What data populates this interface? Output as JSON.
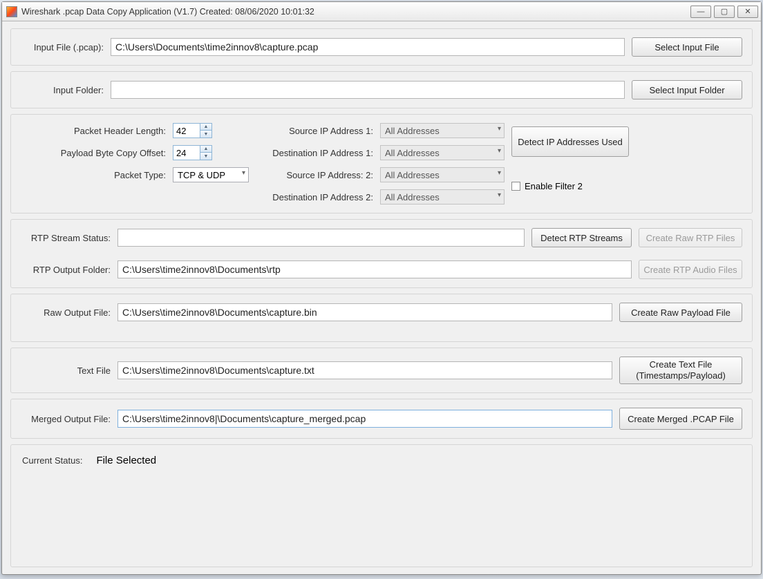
{
  "window": {
    "title": "Wireshark .pcap Data Copy Application (V1.7) Created: 08/06/2020 10:01:32"
  },
  "inputFile": {
    "label": "Input File (.pcap):",
    "value": "C:\\Users\\Documents\\time2innov8\\capture.pcap",
    "button": "Select Input File"
  },
  "inputFolder": {
    "label": "Input Folder:",
    "value": "",
    "button": "Select Input Folder"
  },
  "config": {
    "packetHeaderLengthLabel": "Packet Header Length:",
    "packetHeaderLength": "42",
    "payloadOffsetLabel": "Payload Byte Copy Offset:",
    "payloadOffset": "24",
    "packetTypeLabel": "Packet Type:",
    "packetType": "TCP & UDP",
    "srcIp1Label": "Source IP Address 1:",
    "dstIp1Label": "Destination IP Address 1:",
    "srcIp2Label": "Source IP Address: 2:",
    "dstIp2Label": "Destination IP Address 2:",
    "allAddresses": "All Addresses",
    "detectIpButton": "Detect IP Addresses Used",
    "enableFilter2": "Enable Filter 2"
  },
  "rtp": {
    "streamStatusLabel": "RTP Stream Status:",
    "streamStatus": "",
    "detectButton": "Detect RTP Streams",
    "createRawButton": "Create Raw RTP Files",
    "outputFolderLabel": "RTP Output Folder:",
    "outputFolder": "C:\\Users\\time2innov8\\Documents\\rtp",
    "createAudioButton": "Create RTP Audio Files"
  },
  "rawOutput": {
    "label": "Raw Output File:",
    "value": "C:\\Users\\time2innov8\\Documents\\capture.bin",
    "button": "Create Raw Payload File"
  },
  "textFile": {
    "label": "Text File",
    "value": "C:\\Users\\time2innov8\\Documents\\capture.txt",
    "buttonLine1": "Create Text File",
    "buttonLine2": "(Timestamps/Payload)"
  },
  "merged": {
    "label": "Merged Output File:",
    "value": "C:\\Users\\time2innov8|\\Documents\\capture_merged.pcap",
    "button": "Create Merged .PCAP File"
  },
  "status": {
    "label": "Current Status:",
    "value": "File Selected"
  }
}
